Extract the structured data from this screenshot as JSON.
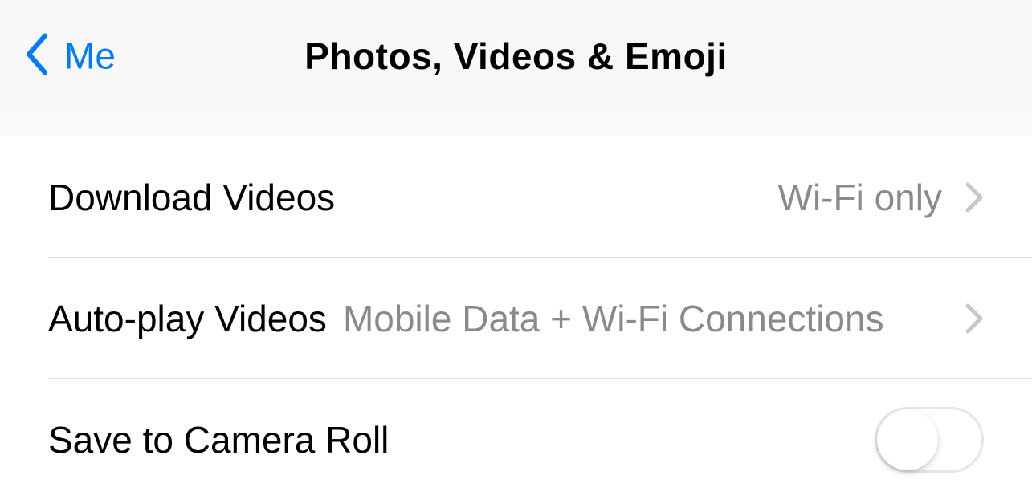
{
  "nav": {
    "back_label": "Me",
    "title": "Photos, Videos & Emoji"
  },
  "rows": {
    "download_videos": {
      "label": "Download Videos",
      "value": "Wi-Fi only"
    },
    "autoplay_videos": {
      "label": "Auto-play Videos",
      "value": "Mobile Data + Wi-Fi Connections"
    },
    "save_camera_roll": {
      "label": "Save to Camera Roll",
      "toggle_on": false
    }
  }
}
